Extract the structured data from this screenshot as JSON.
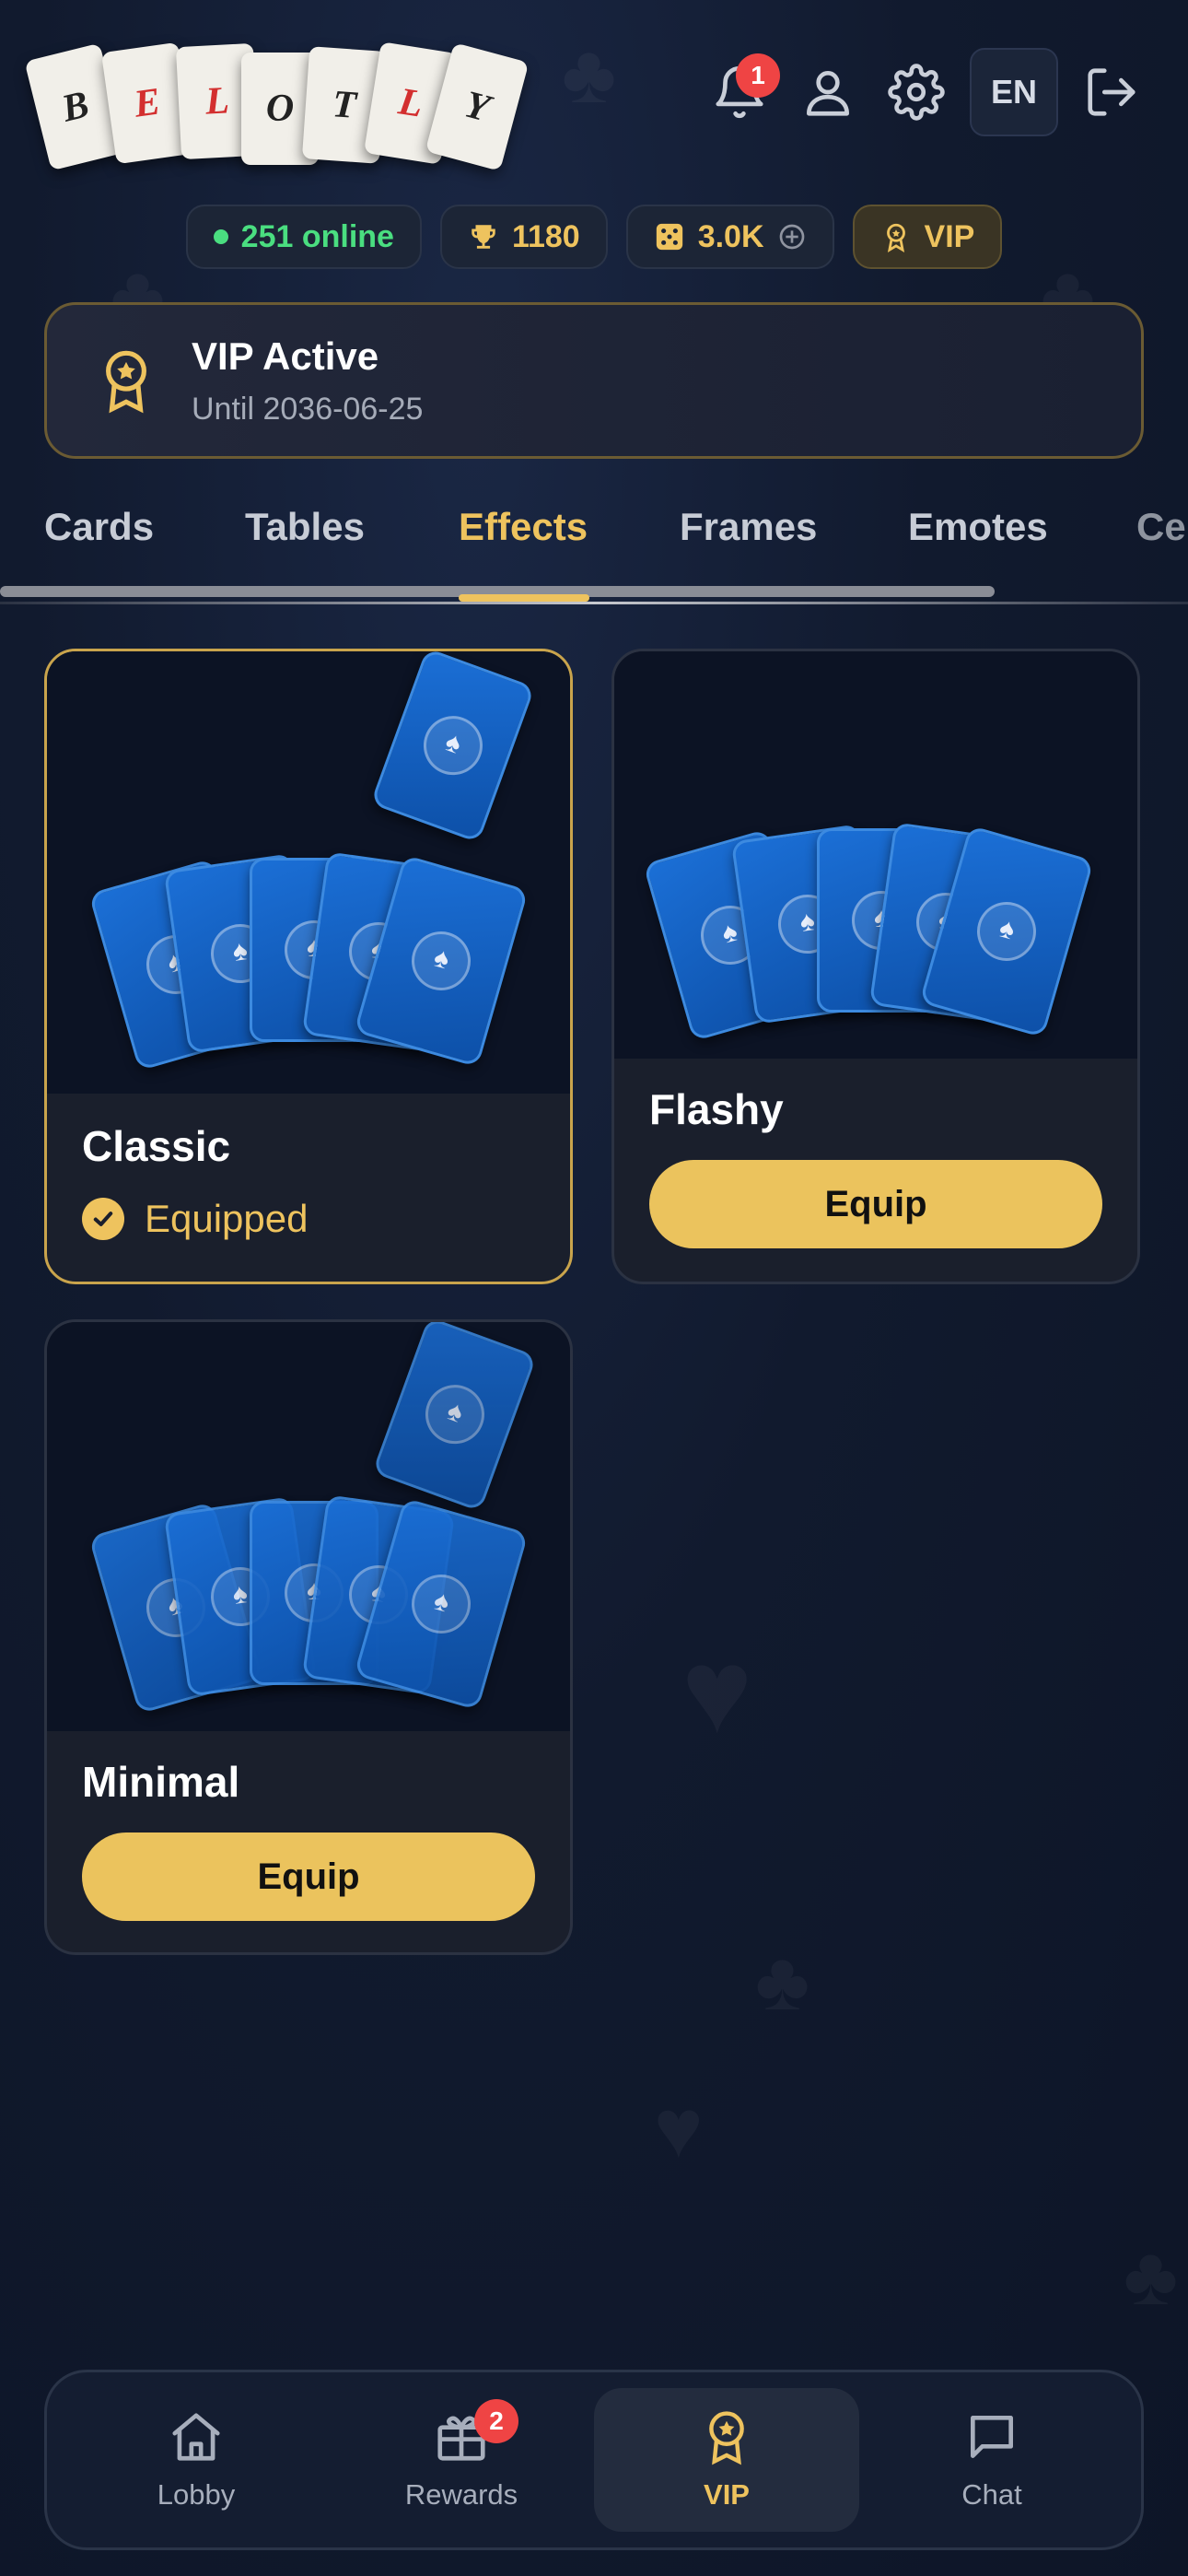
{
  "logo": {
    "letters": [
      "B",
      "E",
      "L",
      "O",
      "T",
      "L",
      "Y"
    ],
    "colors": [
      "#222",
      "#d32f2f",
      "#d32f2f",
      "#222",
      "#222",
      "#d32f2f",
      "#222"
    ]
  },
  "header": {
    "notifications_badge": "1",
    "language": "EN",
    "icons": [
      "bell-icon",
      "user-icon",
      "gear-icon",
      "logout-icon"
    ]
  },
  "stats": {
    "online": "251 online",
    "trophies": "1180",
    "coins": "3.0K",
    "vip": "VIP"
  },
  "vip_banner": {
    "title": "VIP Active",
    "subtitle": "Until 2036-06-25"
  },
  "tabs": [
    {
      "label": "Cards"
    },
    {
      "label": "Tables"
    },
    {
      "label": "Effects",
      "active": true
    },
    {
      "label": "Frames"
    },
    {
      "label": "Emotes"
    },
    {
      "label": "Ce"
    }
  ],
  "effects": [
    {
      "name": "Classic",
      "status": "Equipped"
    },
    {
      "name": "Flashy",
      "button": "Equip"
    },
    {
      "name": "Minimal",
      "button": "Equip"
    }
  ],
  "bottom_nav": [
    {
      "label": "Lobby",
      "icon": "home-icon"
    },
    {
      "label": "Rewards",
      "icon": "gift-icon",
      "badge": "2"
    },
    {
      "label": "VIP",
      "icon": "medal-icon",
      "active": true
    },
    {
      "label": "Chat",
      "icon": "chat-icon"
    }
  ],
  "colors": {
    "accent": "#eec35e",
    "online": "#4ade80",
    "badge": "#ef4444",
    "card_blue": "#1b6fd6"
  }
}
